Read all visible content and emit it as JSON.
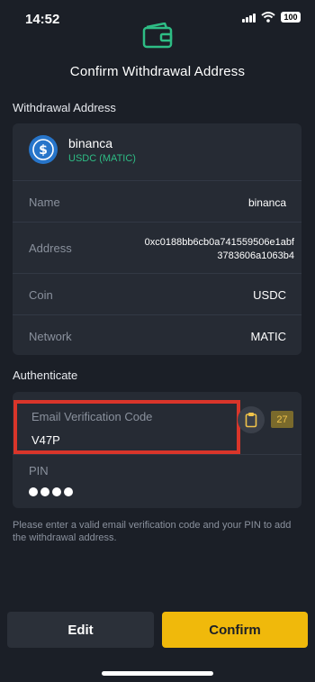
{
  "status_bar": {
    "time": "14:52",
    "battery": "100"
  },
  "header": {
    "title": "Confirm Withdrawal Address"
  },
  "withdrawal": {
    "section_title": "Withdrawal Address",
    "account_name": "binanca",
    "coin_network": "USDC (MATIC)",
    "rows": [
      {
        "label": "Name",
        "value": "binanca"
      },
      {
        "label": "Address",
        "value_line1": "0xc0188bb6cb0a741559506e1abf",
        "value_line2": "3783606a1063b4"
      },
      {
        "label": "Coin",
        "value": "USDC"
      },
      {
        "label": "Network",
        "value": "MATIC"
      }
    ]
  },
  "auth": {
    "section_title": "Authenticate",
    "email_label": "Email Verification Code",
    "email_value": "V47P",
    "timer": "27",
    "pin_label": "PIN"
  },
  "hint": "Please enter a valid email verification code and your PIN to add the withdrawal address.",
  "buttons": {
    "edit": "Edit",
    "confirm": "Confirm"
  },
  "colors": {
    "accent": "#f0b90b",
    "coin_blue": "#2775ca",
    "success_green": "#2ebd85",
    "highlight_red": "#d9352a"
  },
  "icons": [
    "wallet-icon",
    "usdc-coin-icon",
    "clipboard-icon",
    "wifi-icon",
    "signal-icon",
    "battery-icon"
  ]
}
